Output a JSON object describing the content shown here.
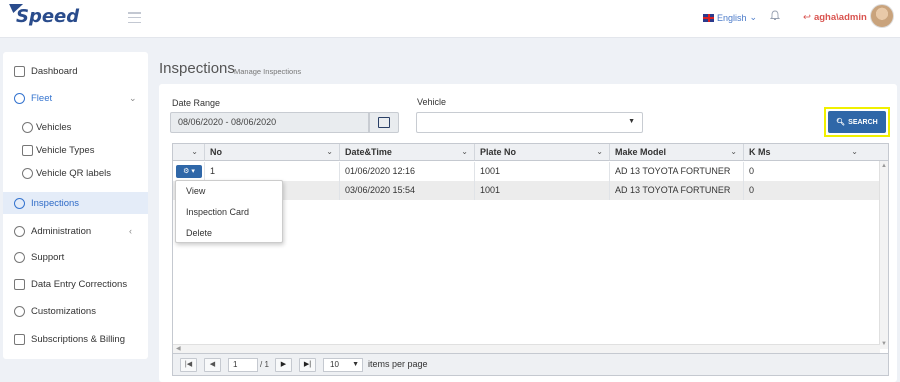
{
  "header": {
    "logo": "Speed",
    "language": "English",
    "user": "agha\\admin"
  },
  "sidebar": {
    "items": [
      {
        "label": "Dashboard"
      },
      {
        "label": "Fleet"
      },
      {
        "label": "Vehicles"
      },
      {
        "label": "Vehicle Types"
      },
      {
        "label": "Vehicle QR labels"
      },
      {
        "label": "Inspections"
      },
      {
        "label": "Administration"
      },
      {
        "label": "Support"
      },
      {
        "label": "Data Entry Corrections"
      },
      {
        "label": "Customizations"
      },
      {
        "label": "Subscriptions & Billing"
      }
    ]
  },
  "page": {
    "title": "Inspections",
    "subtitle": "Manage Inspections"
  },
  "filters": {
    "date_label": "Date Range",
    "date_value": "08/06/2020 - 08/06/2020",
    "vehicle_label": "Vehicle",
    "vehicle_value": "",
    "search_label": "SEARCH"
  },
  "grid": {
    "columns": [
      "No",
      "Date&Time",
      "Plate No",
      "Make Model",
      "K Ms"
    ],
    "rows": [
      {
        "no": "1",
        "datetime": "01/06/2020 12:16",
        "plate": "1001",
        "model": "AD 13 TOYOTA FORTUNER",
        "kms": "0"
      },
      {
        "no": "",
        "datetime": "03/06/2020 15:54",
        "plate": "1001",
        "model": "AD 13 TOYOTA FORTUNER",
        "kms": "0"
      }
    ]
  },
  "action_menu": {
    "items": [
      "View",
      "Inspection Card",
      "Delete"
    ]
  },
  "pager": {
    "page": "1",
    "of_text": "/ 1",
    "page_size": "10",
    "per_page_text": "items per page"
  }
}
